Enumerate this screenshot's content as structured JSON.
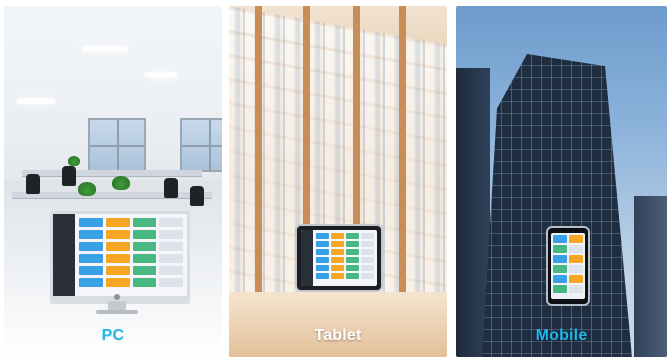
{
  "panels": [
    {
      "id": "pc",
      "label": "PC"
    },
    {
      "id": "tablet",
      "label": "Tablet"
    },
    {
      "id": "mobile",
      "label": "Mobile"
    }
  ],
  "colors": {
    "caption_accent": "#1fb6e8",
    "dashboard_cell_blue": "#3aa0e6",
    "dashboard_cell_orange": "#f5a623",
    "dashboard_cell_green": "#47b881",
    "dashboard_cell_gray": "#dde3ea",
    "dashboard_sidebar": "#2b3038"
  }
}
